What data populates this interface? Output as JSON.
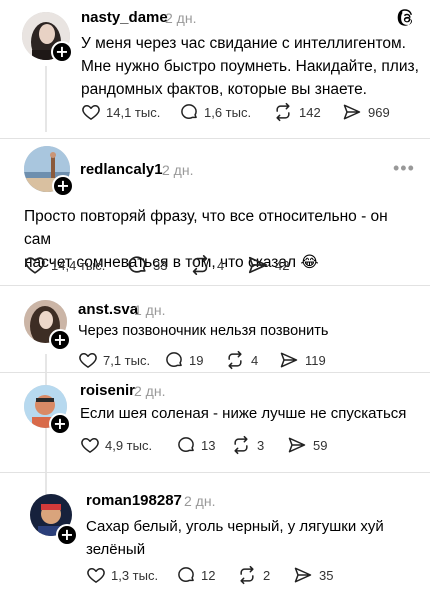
{
  "posts": [
    {
      "username": "nasty_dame",
      "time": "2 дн.",
      "text": [
        "У меня через час свидание с интеллигентом.",
        "Мне нужно быстро поумнеть. Накидайте, плиз,",
        "рандомных фактов, которые вы знаете."
      ],
      "likes": "14,1 тыс.",
      "comments": "1,6 тыс.",
      "reposts": "142",
      "shares": "969",
      "avatar_colors": [
        "#3b3432",
        "#d9c7bd"
      ]
    },
    {
      "username": "redlancaly1",
      "time": "2 дн.",
      "text": [
        "Просто повторяй фразу, что все относительно - он сам",
        "насчет сомневаться в том, что сказал 😂"
      ],
      "likes": "14,4 тыс.",
      "comments": "33",
      "reposts": "4",
      "shares": "42",
      "avatar_colors": [
        "#8fb2d4",
        "#c9a37b"
      ]
    },
    {
      "username": "anst.sva",
      "time": "1 дн.",
      "text": [
        "Через позвоночник нельзя позвонить"
      ],
      "likes": "7,1 тыс.",
      "comments": "19",
      "reposts": "4",
      "shares": "119",
      "avatar_colors": [
        "#4a3a30",
        "#e3cfc1"
      ]
    },
    {
      "username": "roisenir",
      "time": "2 дн.",
      "text": [
        "Если шея соленая - ниже лучше не спускаться"
      ],
      "likes": "4,9 тыс.",
      "comments": "13",
      "reposts": "3",
      "shares": "59",
      "avatar_colors": [
        "#9cc9e8",
        "#d77a55"
      ]
    },
    {
      "username": "roman198287",
      "time": "2 дн.",
      "text": [
        "Сахар белый, уголь черный, у лягушки хуй",
        "зелёный"
      ],
      "likes": "1,3 тыс.",
      "comments": "12",
      "reposts": "2",
      "shares": "35",
      "avatar_colors": [
        "#1d2a4a",
        "#d8a27a"
      ]
    }
  ],
  "icons": {
    "threads": "threads-logo-icon",
    "more": "more-options-icon",
    "like": "heart-icon",
    "comment": "comment-icon",
    "repost": "repost-icon",
    "share": "share-icon"
  }
}
